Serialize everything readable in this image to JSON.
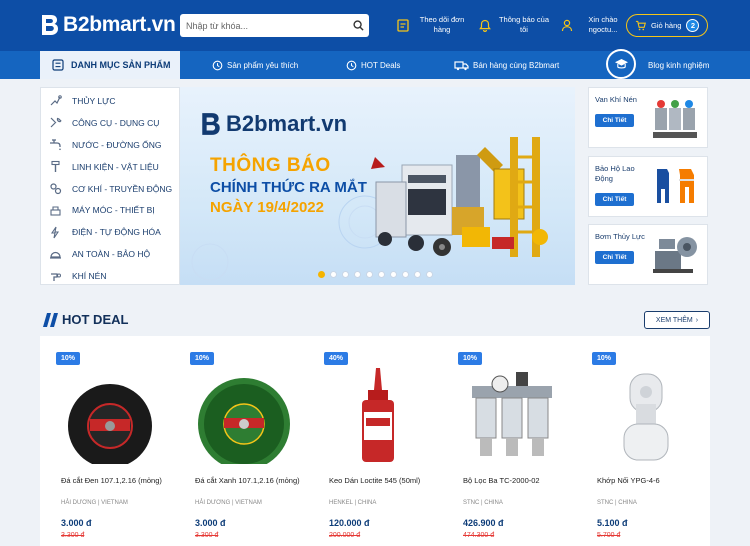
{
  "colors": {
    "header": "#0d4ea6",
    "nav": "#1565c0",
    "accent": "#f5c518",
    "badge": "#2c7be5",
    "old_price": "#e53935"
  },
  "header": {
    "logo": "B2bmart.vn",
    "search": {
      "placeholder": "Nhập từ khóa...",
      "value": ""
    },
    "links": [
      {
        "icon": "order-tracking-icon",
        "label": "Theo dõi đơn hàng"
      },
      {
        "icon": "bell-icon",
        "label": "Thông báo của tôi"
      },
      {
        "icon": "user-icon",
        "label": "Xin chào ngoctu..."
      }
    ],
    "cart": {
      "label": "Giỏ hàng",
      "count": "2"
    }
  },
  "nav": {
    "category_tab": "DANH MỤC SẢN PHẨM",
    "items": [
      {
        "icon": "heart-history-icon",
        "label": "Sản phẩm yêu thích"
      },
      {
        "icon": "clock-icon",
        "label": "HOT Deals"
      },
      {
        "icon": "truck-icon",
        "label": "Bán hàng cùng B2bmart"
      },
      {
        "icon": "graduation-cap-icon",
        "label": "Blog kinh nghiệm"
      }
    ]
  },
  "categories": [
    {
      "icon": "hydraulic-icon",
      "label": "THỦY LỰC"
    },
    {
      "icon": "tools-icon",
      "label": "CÔNG CỤ - DỤNG CỤ"
    },
    {
      "icon": "faucet-icon",
      "label": "NƯỚC - ĐƯỜNG ỐNG"
    },
    {
      "icon": "bolt-part-icon",
      "label": "LINH KIỆN - VẬT LIỆU"
    },
    {
      "icon": "gear-transmission-icon",
      "label": "CƠ KHÍ - TRUYỀN ĐỘNG"
    },
    {
      "icon": "machine-icon",
      "label": "MÁY MÓC - THIẾT BỊ"
    },
    {
      "icon": "automation-icon",
      "label": "ĐIỆN - TỰ ĐỘNG HÓA"
    },
    {
      "icon": "safety-helmet-icon",
      "label": "AN TOÀN - BẢO HỘ"
    },
    {
      "icon": "pneumatic-icon",
      "label": "KHÍ NÉN"
    }
  ],
  "banner": {
    "logo": "B2bmart.vn",
    "line1": "THÔNG BÁO",
    "line2": "CHÍNH THỨC RA MẮT",
    "line3": "NGÀY 19/4/2022",
    "active_slide": 1,
    "slide_count": 10
  },
  "promos": [
    {
      "title": "Van Khí Nén",
      "button": "Chi Tiết"
    },
    {
      "title": "Bảo Hộ Lao Động",
      "button": "Chi Tiết"
    },
    {
      "title": "Bơm Thủy Lực",
      "button": "Chi Tiết"
    }
  ],
  "hot_deal": {
    "title": "HOT DEAL",
    "view_more": "XEM THÊM",
    "products": [
      {
        "badge": "10%",
        "name": "Đá cắt Đen 107.1,2.16 (mỏng)",
        "origin": "HẢI DƯƠNG | VIETNAM",
        "price": "3.000 đ",
        "old_price": "3.300 đ"
      },
      {
        "badge": "10%",
        "name": "Đá cắt Xanh 107.1,2.16 (mỏng)",
        "origin": "HẢI DƯƠNG | VIETNAM",
        "price": "3.000 đ",
        "old_price": "3.300 đ"
      },
      {
        "badge": "40%",
        "name": "Keo Dán Loctite 545 (50ml)",
        "origin": "HENKEL | CHINA",
        "price": "120.000 đ",
        "old_price": "200.000 đ"
      },
      {
        "badge": "10%",
        "name": "Bộ Lọc Ba TC-2000-02",
        "origin": "STNC | CHINA",
        "price": "426.900 đ",
        "old_price": "474.300 đ"
      },
      {
        "badge": "10%",
        "name": "Khớp Nối YPG-4-6",
        "origin": "STNC | CHINA",
        "price": "5.100 đ",
        "old_price": "5.700 đ"
      }
    ]
  }
}
